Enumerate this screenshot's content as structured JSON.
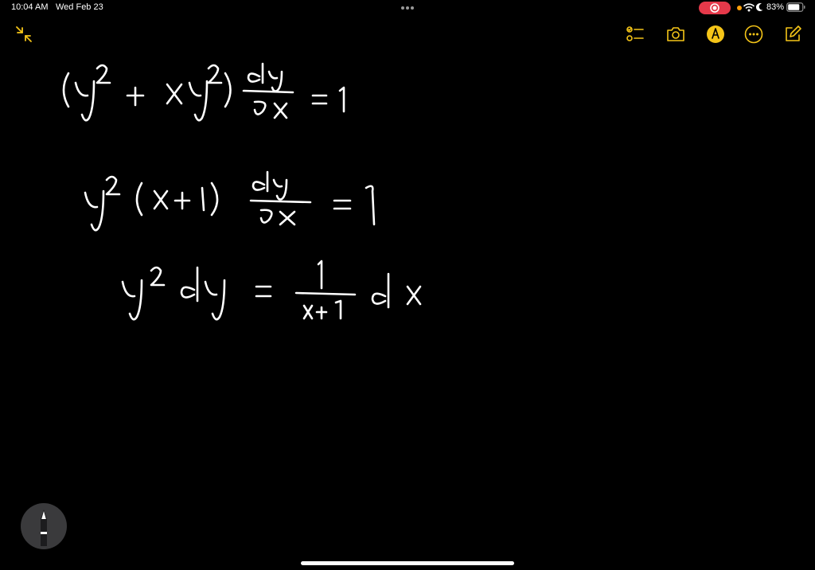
{
  "status_bar": {
    "time": "10:04 AM",
    "date": "Wed Feb 23",
    "battery_percent": "83%",
    "battery_level": 0.83
  },
  "toolbar": {
    "left_icon": "collapse-arrows-icon",
    "right_icons": [
      "checklist-icon",
      "camera-icon",
      "markup-pen-icon",
      "more-icon",
      "compose-icon"
    ]
  },
  "note": {
    "handwritten_lines": [
      "(y^2 + xy^2) dy/dx = 1",
      "y^2 (x+1) dy/dx = 1",
      "y^2 dy = 1/(x+1) dx"
    ]
  },
  "colors": {
    "background": "#000000",
    "ink": "#ffffff",
    "accent": "#f5c518",
    "record": "#e5394a"
  }
}
